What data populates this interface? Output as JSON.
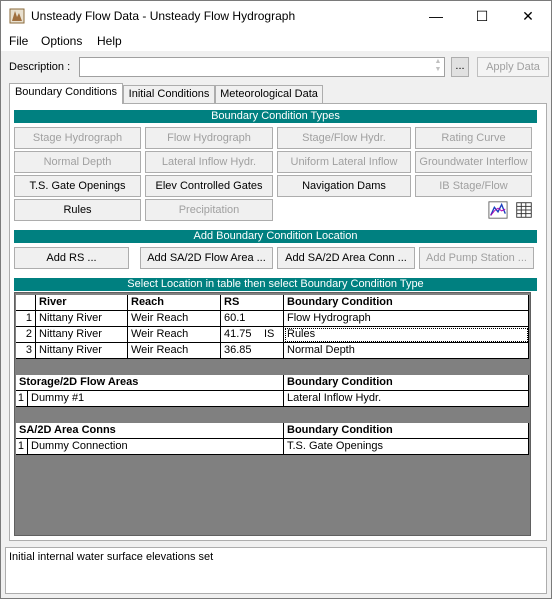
{
  "window": {
    "title": "Unsteady Flow Data - Unsteady Flow Hydrograph",
    "controls": {
      "minimize": "—",
      "maximize": "☐",
      "close": "✕"
    }
  },
  "menu": {
    "items": [
      "File",
      "Options",
      "Help"
    ]
  },
  "description": {
    "label": "Description :",
    "value": "",
    "dots_label": "...",
    "apply_label": "Apply Data"
  },
  "tabs": [
    {
      "label": "Boundary Conditions",
      "active": true
    },
    {
      "label": "Initial Conditions",
      "active": false
    },
    {
      "label": "Meteorological Data",
      "active": false
    }
  ],
  "bc_types": {
    "title": "Boundary Condition Types",
    "buttons": [
      {
        "label": "Stage Hydrograph",
        "enabled": false
      },
      {
        "label": "Flow Hydrograph",
        "enabled": false
      },
      {
        "label": "Stage/Flow Hydr.",
        "enabled": false
      },
      {
        "label": "Rating Curve",
        "enabled": false
      },
      {
        "label": "Normal Depth",
        "enabled": false
      },
      {
        "label": "Lateral Inflow Hydr.",
        "enabled": false
      },
      {
        "label": "Uniform Lateral Inflow",
        "enabled": false
      },
      {
        "label": "Groundwater Interflow",
        "enabled": false
      },
      {
        "label": "T.S. Gate Openings",
        "enabled": true
      },
      {
        "label": "Elev Controlled Gates",
        "enabled": true
      },
      {
        "label": "Navigation Dams",
        "enabled": true
      },
      {
        "label": "IB Stage/Flow",
        "enabled": false
      },
      {
        "label": "Rules",
        "enabled": true
      },
      {
        "label": "Precipitation",
        "enabled": false
      }
    ],
    "icons": [
      "chart-icon",
      "table-icon"
    ]
  },
  "add_location": {
    "title": "Add Boundary Condition Location",
    "buttons": [
      {
        "label": "Add RS ...",
        "enabled": true
      },
      {
        "label": "Add SA/2D Flow Area ...",
        "enabled": true
      },
      {
        "label": "Add SA/2D Area Conn ...",
        "enabled": true
      },
      {
        "label": "Add Pump Station ...",
        "enabled": false
      }
    ]
  },
  "select_bar": {
    "title": "Select Location in table then select Boundary Condition Type"
  },
  "table": {
    "river_headers": [
      "River",
      "Reach",
      "RS",
      "Boundary Condition"
    ],
    "river_rows": [
      {
        "n": "1",
        "river": "Nittany River",
        "reach": "Weir Reach",
        "rs": "60.1",
        "rs_tag": "",
        "bc": "Flow Hydrograph"
      },
      {
        "n": "2",
        "river": "Nittany River",
        "reach": "Weir Reach",
        "rs": "41.75",
        "rs_tag": "IS",
        "bc": "Rules"
      },
      {
        "n": "3",
        "river": "Nittany River",
        "reach": "Weir Reach",
        "rs": "36.85",
        "rs_tag": "",
        "bc": "Normal Depth"
      }
    ],
    "storage_headers": [
      "Storage/2D Flow Areas",
      "Boundary Condition"
    ],
    "storage_rows": [
      {
        "n": "1",
        "name": "Dummy #1",
        "bc": "Lateral Inflow Hydr."
      }
    ],
    "conn_headers": [
      "SA/2D Area Conns",
      "Boundary Condition"
    ],
    "conn_rows": [
      {
        "n": "1",
        "name": "Dummy Connection",
        "bc": "T.S. Gate Openings"
      }
    ]
  },
  "status": {
    "text": "Initial internal water surface elevations set"
  },
  "colors": {
    "section_bar": "#008080",
    "grid_bg": "#808080"
  }
}
